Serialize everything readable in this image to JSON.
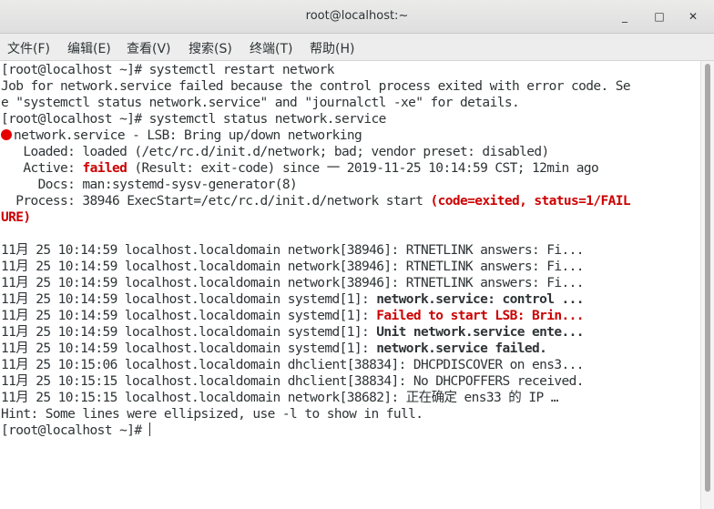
{
  "window": {
    "title": "root@localhost:~",
    "minimize": "_",
    "maximize": "□",
    "close": "✕"
  },
  "menu": [
    "文件(F)",
    "编辑(E)",
    "查看(V)",
    "搜索(S)",
    "终端(T)",
    "帮助(H)"
  ],
  "terminal": {
    "l1": "[root@localhost ~]# systemctl restart network",
    "l2": "Job for network.service failed because the control process exited with error code. Se",
    "l3": "e \"systemctl status network.service\" and \"journalctl -xe\" for details.",
    "l4": "[root@localhost ~]# systemctl status network.service",
    "l5": "network.service - LSB: Bring up/down networking",
    "l6": "   Loaded: loaded (/etc/rc.d/init.d/network; bad; vendor preset: disabled)",
    "l7a": "   Active: ",
    "l7b": "failed",
    "l7c": " (Result: exit-code) since 一 2019-11-25 10:14:59 CST; 12min ago",
    "l8": "     Docs: man:systemd-sysv-generator(8)",
    "l9a": "  Process: 38946 ExecStart=/etc/rc.d/init.d/network start ",
    "l9b": "(code=exited, status=1/FAIL",
    "l10": "URE)",
    "log": [
      {
        "prefix": "11月 25 10:14:59 localhost.localdomain network[38946]: ",
        "msg": "RTNETLINK answers: Fi...",
        "style": ""
      },
      {
        "prefix": "11月 25 10:14:59 localhost.localdomain network[38946]: ",
        "msg": "RTNETLINK answers: Fi...",
        "style": ""
      },
      {
        "prefix": "11月 25 10:14:59 localhost.localdomain network[38946]: ",
        "msg": "RTNETLINK answers: Fi...",
        "style": ""
      },
      {
        "prefix": "11月 25 10:14:59 localhost.localdomain systemd[1]: ",
        "msg": "network.service: control ...",
        "style": "bold"
      },
      {
        "prefix": "11月 25 10:14:59 localhost.localdomain systemd[1]: ",
        "msg": "Failed to start LSB: Brin...",
        "style": "red"
      },
      {
        "prefix": "11月 25 10:14:59 localhost.localdomain systemd[1]: ",
        "msg": "Unit network.service ente...",
        "style": "bold"
      },
      {
        "prefix": "11月 25 10:14:59 localhost.localdomain systemd[1]: ",
        "msg": "network.service failed.",
        "style": "bold"
      },
      {
        "prefix": "11月 25 10:15:06 localhost.localdomain dhclient[38834]: ",
        "msg": "DHCPDISCOVER on ens3...",
        "style": ""
      },
      {
        "prefix": "11月 25 10:15:15 localhost.localdomain dhclient[38834]: ",
        "msg": "No DHCPOFFERS received.",
        "style": ""
      },
      {
        "prefix": "11月 25 10:15:15 localhost.localdomain network[38682]: ",
        "msg": "正在确定 ens33 的 IP …",
        "style": ""
      }
    ],
    "hint": "Hint: Some lines were ellipsized, use -l to show in full.",
    "prompt": "[root@localhost ~]# "
  }
}
